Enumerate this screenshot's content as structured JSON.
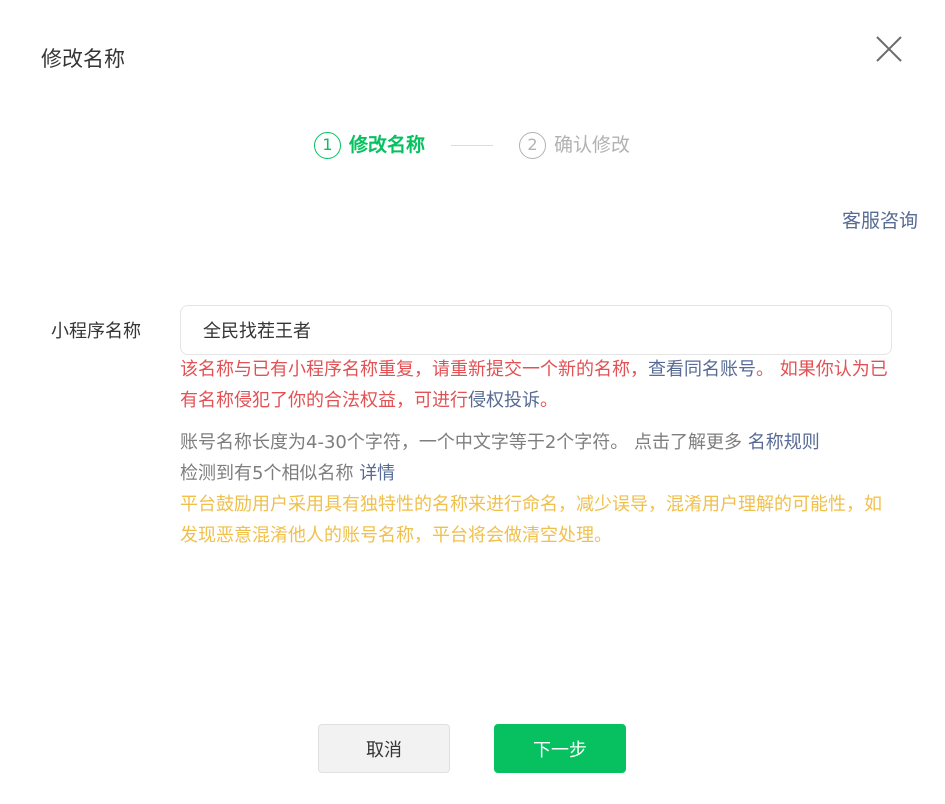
{
  "dialog": {
    "title": "修改名称"
  },
  "steps": [
    {
      "number": "1",
      "label": "修改名称",
      "state": "active"
    },
    {
      "number": "2",
      "label": "确认修改",
      "state": "inactive"
    }
  ],
  "service_link": "客服咨询",
  "form": {
    "label": "小程序名称",
    "value": "全民找茬王者"
  },
  "error": {
    "text_1": "该名称与已有小程序名称重复，请重新提交一个新的名称，",
    "link_1": "查看同名账号",
    "text_2": "。 如果你认为已有名称侵犯了你的合法权益，可进行",
    "link_2": "侵权投诉",
    "text_3": "。"
  },
  "info": {
    "line1_text": "账号名称长度为4-30个字符，一个中文字等于2个字符。 点击了解更多",
    "rules_link": "名称规则",
    "line2_text": "检测到有5个相似名称",
    "details_link": "详情"
  },
  "warning": "平台鼓励用户采用具有独特性的名称来进行命名，减少误导，混淆用户理解的可能性，如发现恶意混淆他人的账号名称，平台将会做清空处理。",
  "buttons": {
    "cancel": "取消",
    "next": "下一步"
  },
  "colors": {
    "primary": "#07c160",
    "error": "#e25154",
    "link": "#576b95",
    "warning": "#f0c04d"
  },
  "icons": {
    "close": "close-icon"
  }
}
